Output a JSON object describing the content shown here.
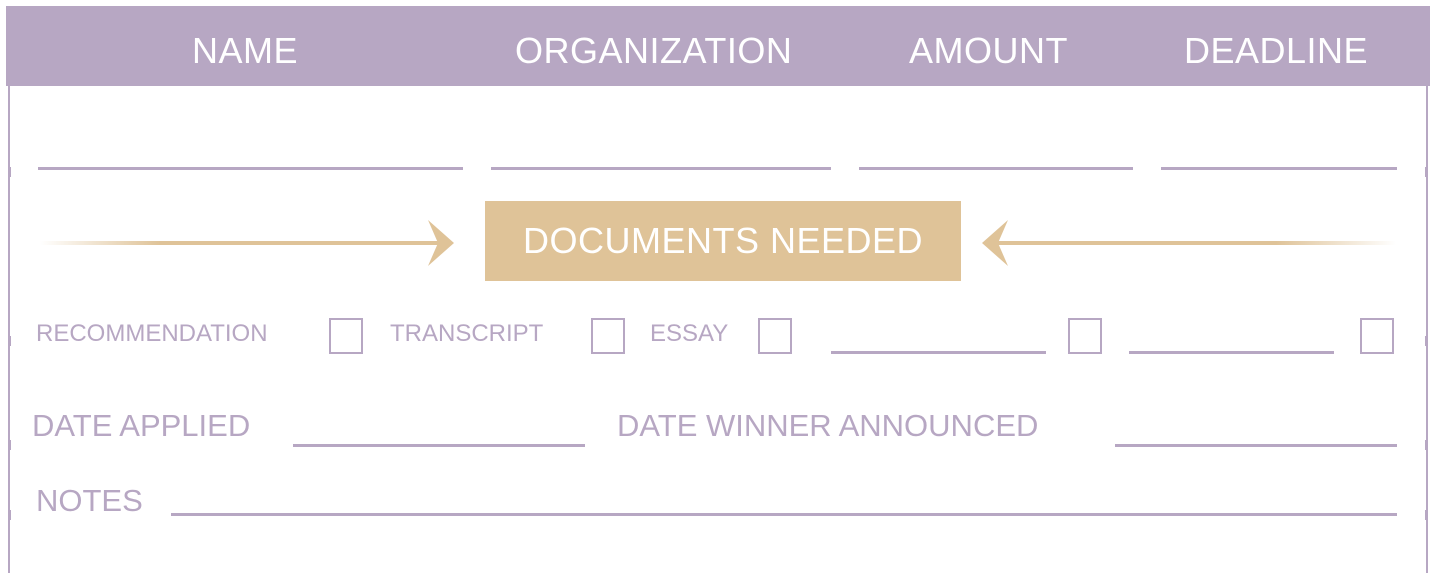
{
  "header": {
    "name": "NAME",
    "organization": "ORGANIZATION",
    "amount": "AMOUNT",
    "deadline": "DEADLINE"
  },
  "documents_needed": {
    "title": "DOCUMENTS NEEDED",
    "recommendation": "RECOMMENDATION",
    "transcript": "TRANSCRIPT",
    "essay": "ESSAY"
  },
  "dates": {
    "applied": "DATE APPLIED",
    "winner_announced": "DATE WINNER ANNOUNCED"
  },
  "notes": {
    "label": "NOTES"
  },
  "colors": {
    "lavender": "#b7a7c3",
    "gold": "#dfc398"
  }
}
